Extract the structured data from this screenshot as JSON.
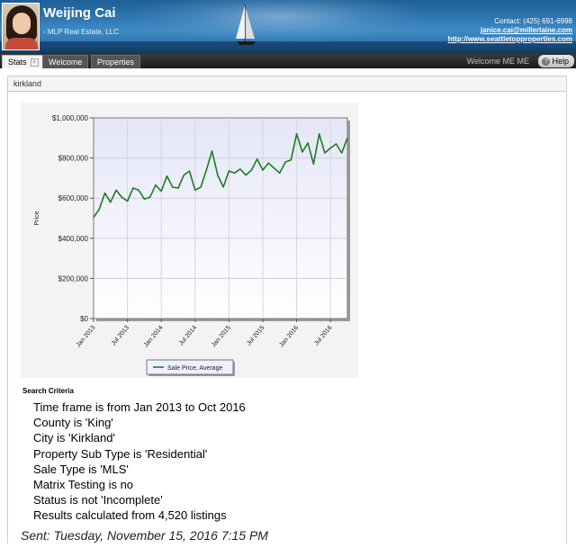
{
  "header": {
    "agent_name": "Weijing Cai",
    "company": "- MLP Real Estate, LLC",
    "contact_label": "Contact: (425) 691-6998",
    "email": "janice.cai@millerlaine.com",
    "website": "http://www.seattletopproperties.com"
  },
  "tabs": [
    {
      "label": "Stats",
      "active": true,
      "closable": true
    },
    {
      "label": "Welcome",
      "active": false
    },
    {
      "label": "Properties",
      "active": false
    }
  ],
  "topbar": {
    "welcome_text": "Welcome ME ME",
    "help_label": "Help"
  },
  "city_bar": {
    "label": "kirkland"
  },
  "chart_data": {
    "type": "line",
    "title": "",
    "xlabel": "",
    "ylabel": "Price",
    "ylim": [
      0,
      1000000
    ],
    "y_ticks": [
      "$0",
      "$200,000",
      "$400,000",
      "$600,000",
      "$800,000",
      "$1,000,000"
    ],
    "x_ticks": [
      "Jan 2013",
      "Jul 2013",
      "Jan 2014",
      "Jul 2014",
      "Jan 2015",
      "Jul 2015",
      "Jan 2016",
      "Jul 2016"
    ],
    "grid": true,
    "legend_placement": "bottom",
    "series": [
      {
        "name": "Sale Price, Average",
        "color": "#1f7a1f",
        "values": [
          505000,
          545000,
          625000,
          580000,
          640000,
          605000,
          585000,
          650000,
          640000,
          595000,
          605000,
          665000,
          635000,
          710000,
          655000,
          650000,
          715000,
          735000,
          640000,
          655000,
          740000,
          835000,
          715000,
          655000,
          735000,
          725000,
          745000,
          715000,
          740000,
          795000,
          740000,
          775000,
          750000,
          725000,
          780000,
          790000,
          920000,
          830000,
          875000,
          770000,
          920000,
          825000,
          850000,
          870000,
          825000,
          900000
        ]
      }
    ]
  },
  "criteria": {
    "title": "Search Criteria",
    "lines": [
      "Time frame is from Jan 2013 to Oct 2016",
      "County is 'King'",
      "City is 'Kirkland'",
      "Property Sub Type is 'Residential'",
      "Sale Type is 'MLS'",
      "Matrix Testing is no",
      "Status is not 'Incomplete'",
      "Results calculated from 4,520 listings"
    ]
  },
  "sent": "Sent: Tuesday, November 15, 2016 7:15 PM"
}
